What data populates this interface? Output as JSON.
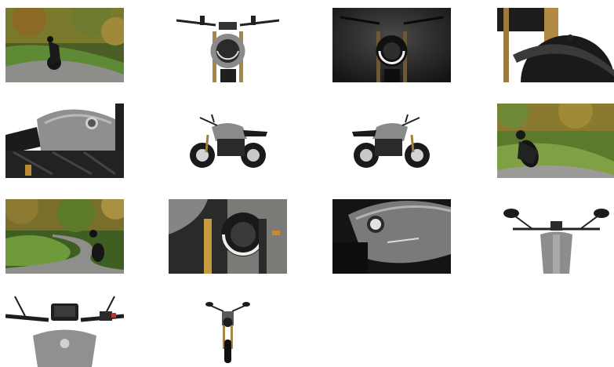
{
  "gallery": {
    "thumbnails": [
      {
        "subject": "rider-cornering-road",
        "bg": "#6f8a3a"
      },
      {
        "subject": "front-view-headlight-white",
        "bg": "#ffffff"
      },
      {
        "subject": "front-view-headlight-dark",
        "bg": "#2a2a2a"
      },
      {
        "subject": "front-wheel-fender-closeup",
        "bg": "#ffffff"
      },
      {
        "subject": "fuel-tank-frame-closeup",
        "bg": "#ffffff"
      },
      {
        "subject": "side-view-bike-right",
        "bg": "#ffffff"
      },
      {
        "subject": "side-view-bike-left",
        "bg": "#ffffff"
      },
      {
        "subject": "rider-lean-curve",
        "bg": "#6a8a34"
      },
      {
        "subject": "rider-winding-road",
        "bg": "#4e6e2a"
      },
      {
        "subject": "headlight-fork-closeup",
        "bg": "#3a3a3a"
      },
      {
        "subject": "tank-badge-600-closeup",
        "bg": "#1e1e1e"
      },
      {
        "subject": "handlebar-tank-top-view",
        "bg": "#ffffff"
      },
      {
        "subject": "cockpit-dash-closeup",
        "bg": "#ffffff"
      },
      {
        "subject": "front-view-full-bike",
        "bg": "#ffffff"
      }
    ]
  }
}
